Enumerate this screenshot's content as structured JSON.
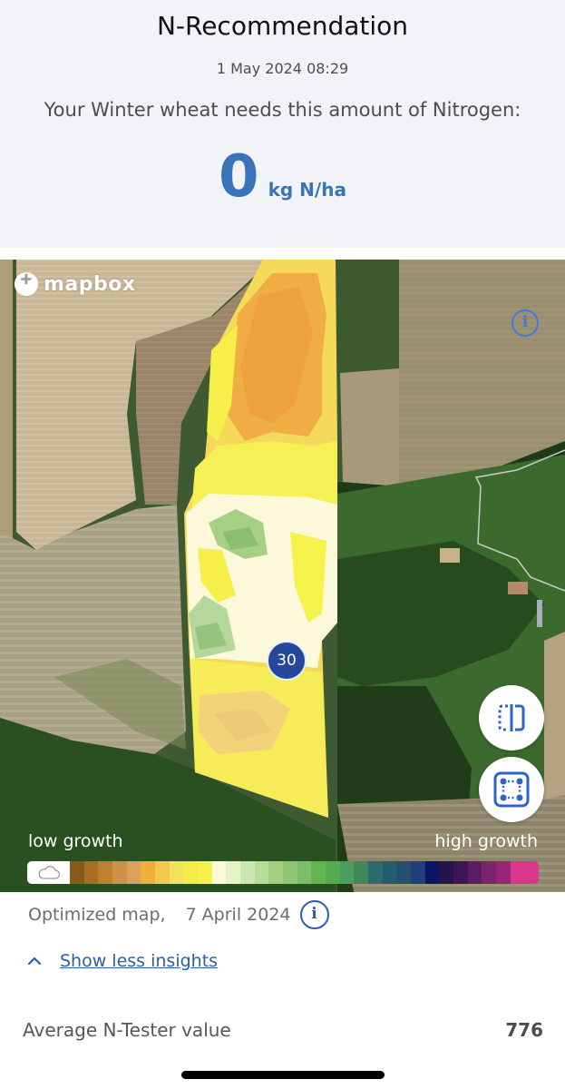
{
  "header": {
    "title": "N-Recommendation",
    "timestamp": "1 May 2024 08:29",
    "prompt": "Your Winter wheat needs this amount of Nitrogen:",
    "amount_value": "0",
    "amount_unit": "kg N/ha",
    "accent_color": "#3a74b8"
  },
  "map": {
    "provider_logo": "mapbox",
    "info_icon": "info-icon",
    "zone_badge": "30",
    "controls": [
      {
        "name": "split-view-button",
        "icon": "split-view-icon"
      },
      {
        "name": "select-area-button",
        "icon": "select-area-icon"
      }
    ],
    "legend": {
      "low_label": "low growth",
      "high_label": "high growth",
      "no_data_icon": "cloud-icon",
      "colors": [
        "#8a5a1c",
        "#a86d24",
        "#bf7f2e",
        "#cf9147",
        "#dba15a",
        "#f2ad3d",
        "#f4c84a",
        "#f1e15c",
        "#f4ec4a",
        "#f6f24c",
        "#fbf9da",
        "#e6f2c8",
        "#cce6b1",
        "#b7dc9a",
        "#a5cf83",
        "#8fc475",
        "#7cbc6a",
        "#63b551",
        "#55ab4f",
        "#4b9e5f",
        "#40875a",
        "#2a6b6b",
        "#245d70",
        "#284f72",
        "#203d7c",
        "#0b1466",
        "#261450",
        "#3f1559",
        "#5a1f63",
        "#7a2470",
        "#99257a",
        "#d8378a"
      ]
    }
  },
  "map_source": {
    "label": "Optimized map,",
    "date": "7 April 2024"
  },
  "insights": {
    "toggle_label": "Show less insights",
    "metrics": [
      {
        "label": "Average N-Tester value",
        "value": "776"
      }
    ]
  }
}
